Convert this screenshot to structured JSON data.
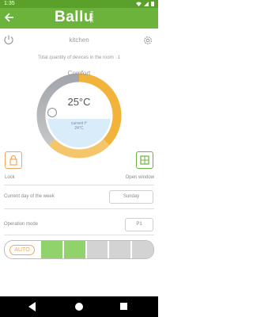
{
  "status_bar": {
    "time": "1:35"
  },
  "header": {
    "brand": "Ballu",
    "brand_sup": "HOME"
  },
  "room": {
    "title": "kitchen",
    "devices_text": "Total quantity of devices in the room : 1"
  },
  "dial": {
    "mode": "Comfort",
    "temperature": "25°C",
    "current_label": "current t°",
    "current_value": "24°C",
    "colors": {
      "cold": "#9aa0a6",
      "warm": "#f2b33a"
    }
  },
  "controls": {
    "lock_label": "Lock",
    "open_window_label": "Open window"
  },
  "day_row": {
    "label": "Current day of the week",
    "value": "Sunday"
  },
  "operation_row": {
    "label": "Operation mode",
    "value": "P1"
  },
  "speed": {
    "auto_label": "AUTO",
    "segments": [
      {
        "color": "#8fd36a"
      },
      {
        "color": "#8fd36a"
      },
      {
        "color": "#d3d3d3"
      },
      {
        "color": "#d3d3d3"
      },
      {
        "color": "#d3d3d3"
      }
    ]
  },
  "accent_colors": {
    "header": "#6bb33a",
    "warning": "#f2a65a"
  }
}
